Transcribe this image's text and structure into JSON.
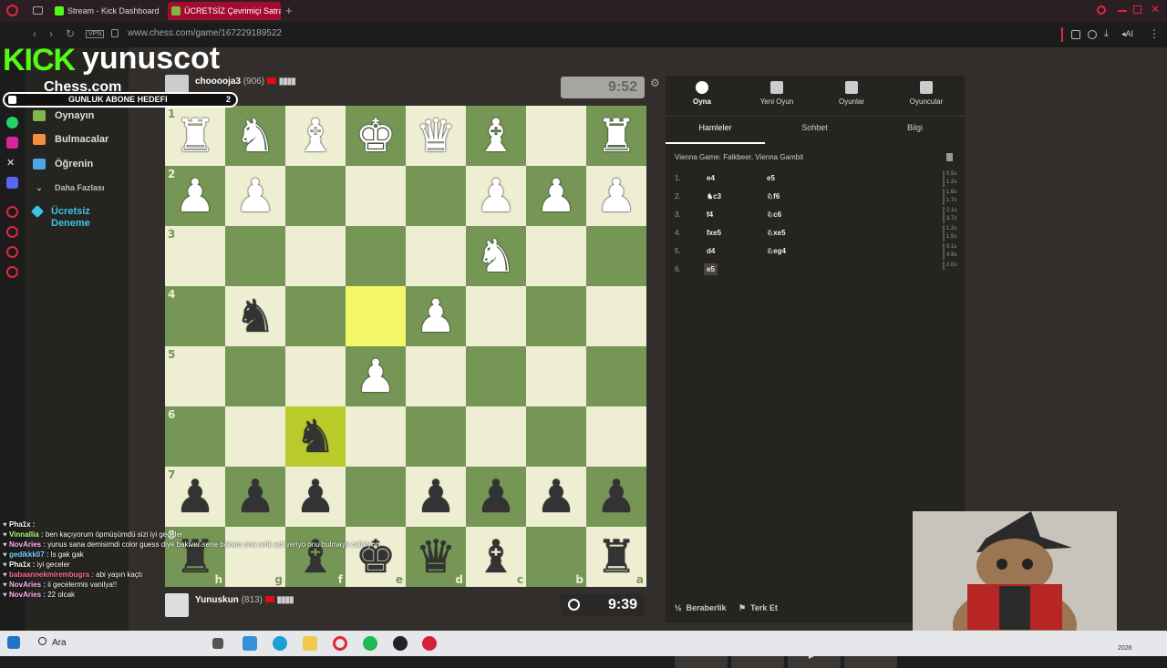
{
  "browser": {
    "tabs": [
      {
        "title": "Stream - Kick Dashboard",
        "active": false
      },
      {
        "title": "ÜCRETSİZ Çevrimiçi Satran",
        "active": true
      }
    ],
    "new_tab": "+",
    "vpn": "VPN",
    "url": "www.chess.com/game/167229189522",
    "ai_label": "AI"
  },
  "stream": {
    "brand": "KICK",
    "username": "yunuscot",
    "goal_label": "GUNLUK ABONE HEDEFI",
    "goal_count": "2"
  },
  "chess_site": {
    "logo": "Chess.com",
    "nav": [
      {
        "label": "Oynayın",
        "color": "#81b64c"
      },
      {
        "label": "Bulmacalar",
        "color": "#f1913e"
      },
      {
        "label": "Öğrenin",
        "color": "#4ea4e8"
      },
      {
        "label": "Daha Fazlası",
        "color": "#999"
      },
      {
        "label": "Ücretsiz Deneme",
        "color": "#3cc4e6"
      }
    ]
  },
  "game": {
    "top_player": {
      "name": "chooooja3",
      "rating": "(906)",
      "clock": "9:52"
    },
    "bottom_player": {
      "name": "Yunuskun",
      "rating": "(813)",
      "clock": "9:39"
    }
  },
  "board": {
    "orientation": "black",
    "rows": [
      [
        "R",
        "N",
        "B",
        "K",
        "Q",
        "B",
        "",
        "R"
      ],
      [
        "P",
        "P",
        "",
        "",
        "",
        "P",
        "P",
        "P"
      ],
      [
        "",
        "",
        "",
        "",
        "",
        "N",
        "",
        ""
      ],
      [
        "",
        "n",
        "",
        "",
        "P",
        "",
        "",
        ""
      ],
      [
        "",
        "",
        "",
        "P",
        "",
        "",
        "",
        ""
      ],
      [
        "",
        "",
        "n",
        "",
        "",
        "",
        "",
        ""
      ],
      [
        "p",
        "p",
        "p",
        "",
        "p",
        "p",
        "p",
        "p"
      ],
      [
        "r",
        "",
        "b",
        "k",
        "q",
        "b",
        "",
        "r"
      ]
    ],
    "ranks": [
      "1",
      "2",
      "3",
      "4",
      "5",
      "6",
      "7",
      "8"
    ],
    "files": [
      "h",
      "g",
      "f",
      "e",
      "d",
      "c",
      "b",
      "a"
    ],
    "highlight": [
      [
        3,
        3
      ],
      [
        5,
        2
      ]
    ]
  },
  "panel": {
    "tabs": [
      {
        "label": "Oyna"
      },
      {
        "label": "Yeni Oyun"
      },
      {
        "label": "Oyunlar"
      },
      {
        "label": "Oyuncular"
      }
    ],
    "subtabs": [
      "Hamleler",
      "Sohbet",
      "Bilgi"
    ],
    "opening": "Vienna Game: Falkbeer, Vienna Gambit",
    "moves": [
      {
        "n": "1.",
        "w": "e4",
        "b": "e5",
        "t1": "0.5s",
        "t2": "1.2s"
      },
      {
        "n": "2.",
        "w": "♞c3",
        "b": "♘f6",
        "t1": "1.6s",
        "t2": "1.7s"
      },
      {
        "n": "3.",
        "w": "f4",
        "b": "♘c6",
        "t1": "2.1s",
        "t2": "3.7s"
      },
      {
        "n": "4.",
        "w": "fxe5",
        "b": "♘xe5",
        "t1": "1.2s",
        "t2": "1.5s"
      },
      {
        "n": "5.",
        "w": "d4",
        "b": "♘eg4",
        "t1": "0.1s",
        "t2": "4.9s"
      },
      {
        "n": "6.",
        "w": "e5",
        "b": "",
        "t1": "2.0s",
        "t2": ""
      }
    ],
    "draw_label": "Beraberlik",
    "resign_label": "Terk Et"
  },
  "chat": [
    {
      "user": "Pha1x :",
      "msg": "",
      "color": "#fff"
    },
    {
      "user": "Vinnallia :",
      "msg": "ben kaçıyorum öpmüşümdü sizi iyi geceler",
      "color": "#b6ff7a"
    },
    {
      "user": "NovAries :",
      "msg": "yunus sana demisimdi color guess diye bakiver sene bakam ona renk adi veriyo onu bulmaya calisiyon",
      "color": "#ffb3f0"
    },
    {
      "user": "gedikkk07 :",
      "msg": "ls gak gak",
      "color": "#7ad4ff"
    },
    {
      "user": "Pha1x :",
      "msg": "iyi geceler",
      "color": "#fff"
    },
    {
      "user": "babaannekmirembugra :",
      "msg": "abi yaşın kaçtı",
      "color": "#ff6f91"
    },
    {
      "user": "NovAries :",
      "msg": "ii gecelermis vanilya!!",
      "color": "#ffb3f0"
    },
    {
      "user": "NovAries :",
      "msg": "22 olcak",
      "color": "#ffb3f0"
    }
  ],
  "taskbar": {
    "search": "Ara",
    "year": "2026"
  }
}
